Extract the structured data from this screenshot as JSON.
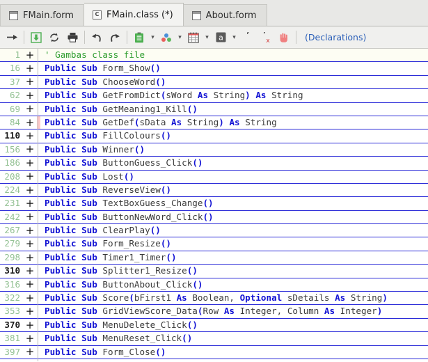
{
  "window": {
    "app": "Gambas IDE code editor"
  },
  "tabs": [
    {
      "label": "FMain.form",
      "icon": "form-window-icon",
      "icon_letter": "",
      "active": false
    },
    {
      "label": "FMain.class (*)",
      "icon": "class-file-icon",
      "icon_letter": "C",
      "active": true
    },
    {
      "label": "About.form",
      "icon": "form-window-icon",
      "icon_letter": "",
      "active": false
    }
  ],
  "toolbar": {
    "buttons": [
      {
        "name": "go-to-icon",
        "glyph": "→",
        "color": "#3c3c3c"
      },
      {
        "name": "save-icon",
        "glyph": "⬇",
        "color": "#4caf50"
      },
      {
        "name": "reload-icon",
        "glyph": "↻",
        "color": "#3c3c3c"
      },
      {
        "name": "print-icon",
        "glyph": "🖶",
        "color": "#3c3c3c"
      },
      {
        "name": "undo-icon",
        "glyph": "↶",
        "color": "#3c3c3c"
      },
      {
        "name": "redo-icon",
        "glyph": "↷",
        "color": "#3c3c3c"
      },
      {
        "name": "clipboard-icon",
        "glyph": "📋",
        "color": "#4caf50"
      },
      {
        "name": "breakpoints-icon",
        "glyph": "●",
        "color": "#4a90d9"
      },
      {
        "name": "calendar-icon",
        "glyph": "▦",
        "color": "#555555"
      },
      {
        "name": "font-icon",
        "glyph": "a",
        "color": "#555555"
      },
      {
        "name": "comment-icon",
        "glyph": "’",
        "color": "#3c3c3c"
      },
      {
        "name": "uncomment-icon",
        "glyph": "’",
        "color": "#3c3c3c"
      },
      {
        "name": "stop-hand-icon",
        "glyph": "✋",
        "color": "#f08080"
      }
    ],
    "declarations_label": "(Declarations)"
  },
  "colors": {
    "keyword": "#1414d4",
    "comment": "#2f9d2f",
    "identifier": "#3a3a3a",
    "line_number": "#93c193",
    "line_number_active": "#1b1b1b",
    "row_separator": "#2b2bd8",
    "modified_marker": "#ffc9c9",
    "toolbar_bg": "#f0f0ee",
    "tab_active_bg": "#f3f3f1"
  },
  "code_lines": [
    {
      "line": "1",
      "numdark": false,
      "flag": false,
      "first": true,
      "parts": [
        {
          "t": "' Gambas class file",
          "c": "cmt"
        }
      ]
    },
    {
      "line": "16",
      "numdark": false,
      "flag": false,
      "parts": [
        {
          "t": "Public Sub ",
          "c": "kw"
        },
        {
          "t": "Form_Show",
          "c": "id"
        },
        {
          "t": "()",
          "c": "punc"
        }
      ]
    },
    {
      "line": "37",
      "numdark": false,
      "flag": false,
      "parts": [
        {
          "t": "Public Sub ",
          "c": "kw"
        },
        {
          "t": "ChooseWord",
          "c": "id"
        },
        {
          "t": "()",
          "c": "punc"
        }
      ]
    },
    {
      "line": "62",
      "numdark": false,
      "flag": false,
      "parts": [
        {
          "t": "Public Sub ",
          "c": "kw"
        },
        {
          "t": "GetFromDict",
          "c": "id"
        },
        {
          "t": "(",
          "c": "punc"
        },
        {
          "t": "sWord ",
          "c": "id"
        },
        {
          "t": "As ",
          "c": "kw"
        },
        {
          "t": "String",
          "c": "id"
        },
        {
          "t": ")",
          "c": "punc"
        },
        {
          "t": " ",
          "c": "id"
        },
        {
          "t": "As ",
          "c": "kw"
        },
        {
          "t": "String",
          "c": "id"
        }
      ]
    },
    {
      "line": "69",
      "numdark": false,
      "flag": false,
      "parts": [
        {
          "t": "Public Sub ",
          "c": "kw"
        },
        {
          "t": "GetMeaning1_Kill",
          "c": "id"
        },
        {
          "t": "()",
          "c": "punc"
        }
      ]
    },
    {
      "line": "84",
      "numdark": false,
      "flag": true,
      "parts": [
        {
          "t": "Public Sub ",
          "c": "kw"
        },
        {
          "t": "GetDef",
          "c": "id"
        },
        {
          "t": "(",
          "c": "punc"
        },
        {
          "t": "sData ",
          "c": "id"
        },
        {
          "t": "As ",
          "c": "kw"
        },
        {
          "t": "String",
          "c": "id"
        },
        {
          "t": ")",
          "c": "punc"
        },
        {
          "t": " ",
          "c": "id"
        },
        {
          "t": "As ",
          "c": "kw"
        },
        {
          "t": "String",
          "c": "id"
        }
      ]
    },
    {
      "line": "110",
      "numdark": true,
      "flag": false,
      "parts": [
        {
          "t": "Public Sub ",
          "c": "kw"
        },
        {
          "t": "FillColours",
          "c": "id"
        },
        {
          "t": "()",
          "c": "punc"
        }
      ]
    },
    {
      "line": "156",
      "numdark": false,
      "flag": false,
      "parts": [
        {
          "t": "Public Sub ",
          "c": "kw"
        },
        {
          "t": "Winner",
          "c": "id"
        },
        {
          "t": "()",
          "c": "punc"
        }
      ]
    },
    {
      "line": "186",
      "numdark": false,
      "flag": false,
      "parts": [
        {
          "t": "Public Sub ",
          "c": "kw"
        },
        {
          "t": "ButtonGuess_Click",
          "c": "id"
        },
        {
          "t": "()",
          "c": "punc"
        }
      ]
    },
    {
      "line": "208",
      "numdark": false,
      "flag": false,
      "parts": [
        {
          "t": "Public Sub ",
          "c": "kw"
        },
        {
          "t": "Lost",
          "c": "id"
        },
        {
          "t": "()",
          "c": "punc"
        }
      ]
    },
    {
      "line": "224",
      "numdark": false,
      "flag": false,
      "parts": [
        {
          "t": "Public Sub ",
          "c": "kw"
        },
        {
          "t": "ReverseView",
          "c": "id"
        },
        {
          "t": "()",
          "c": "punc"
        }
      ]
    },
    {
      "line": "231",
      "numdark": false,
      "flag": false,
      "parts": [
        {
          "t": "Public Sub ",
          "c": "kw"
        },
        {
          "t": "TextBoxGuess_Change",
          "c": "id"
        },
        {
          "t": "()",
          "c": "punc"
        }
      ]
    },
    {
      "line": "242",
      "numdark": false,
      "flag": false,
      "parts": [
        {
          "t": "Public Sub ",
          "c": "kw"
        },
        {
          "t": "ButtonNewWord_Click",
          "c": "id"
        },
        {
          "t": "()",
          "c": "punc"
        }
      ]
    },
    {
      "line": "267",
      "numdark": false,
      "flag": false,
      "parts": [
        {
          "t": "Public Sub ",
          "c": "kw"
        },
        {
          "t": "ClearPlay",
          "c": "id"
        },
        {
          "t": "()",
          "c": "punc"
        }
      ]
    },
    {
      "line": "279",
      "numdark": false,
      "flag": false,
      "parts": [
        {
          "t": "Public Sub ",
          "c": "kw"
        },
        {
          "t": "Form_Resize",
          "c": "id"
        },
        {
          "t": "()",
          "c": "punc"
        }
      ]
    },
    {
      "line": "298",
      "numdark": false,
      "flag": false,
      "parts": [
        {
          "t": "Public Sub ",
          "c": "kw"
        },
        {
          "t": "Timer1_Timer",
          "c": "id"
        },
        {
          "t": "()",
          "c": "punc"
        }
      ]
    },
    {
      "line": "310",
      "numdark": true,
      "flag": false,
      "parts": [
        {
          "t": "Public Sub ",
          "c": "kw"
        },
        {
          "t": "Splitter1_Resize",
          "c": "id"
        },
        {
          "t": "()",
          "c": "punc"
        }
      ]
    },
    {
      "line": "316",
      "numdark": false,
      "flag": false,
      "parts": [
        {
          "t": "Public Sub ",
          "c": "kw"
        },
        {
          "t": "ButtonAbout_Click",
          "c": "id"
        },
        {
          "t": "()",
          "c": "punc"
        }
      ]
    },
    {
      "line": "322",
      "numdark": false,
      "flag": false,
      "parts": [
        {
          "t": "Public Sub ",
          "c": "kw"
        },
        {
          "t": "Score",
          "c": "id"
        },
        {
          "t": "(",
          "c": "punc"
        },
        {
          "t": "bFirst1 ",
          "c": "id"
        },
        {
          "t": "As ",
          "c": "kw"
        },
        {
          "t": "Boolean, ",
          "c": "id"
        },
        {
          "t": "Optional ",
          "c": "kw"
        },
        {
          "t": "sDetails ",
          "c": "id"
        },
        {
          "t": "As ",
          "c": "kw"
        },
        {
          "t": "String",
          "c": "id"
        },
        {
          "t": ")",
          "c": "punc"
        }
      ]
    },
    {
      "line": "353",
      "numdark": false,
      "flag": false,
      "parts": [
        {
          "t": "Public Sub ",
          "c": "kw"
        },
        {
          "t": "GridViewScore_Data",
          "c": "id"
        },
        {
          "t": "(",
          "c": "punc"
        },
        {
          "t": "Row ",
          "c": "id"
        },
        {
          "t": "As ",
          "c": "kw"
        },
        {
          "t": "Integer, ",
          "c": "id"
        },
        {
          "t": "Column ",
          "c": "id"
        },
        {
          "t": "As ",
          "c": "kw"
        },
        {
          "t": "Integer",
          "c": "id"
        },
        {
          "t": ")",
          "c": "punc"
        }
      ]
    },
    {
      "line": "370",
      "numdark": true,
      "flag": false,
      "parts": [
        {
          "t": "Public Sub ",
          "c": "kw"
        },
        {
          "t": "MenuDelete_Click",
          "c": "id"
        },
        {
          "t": "()",
          "c": "punc"
        }
      ]
    },
    {
      "line": "381",
      "numdark": false,
      "flag": false,
      "parts": [
        {
          "t": "Public Sub ",
          "c": "kw"
        },
        {
          "t": "MenuReset_Click",
          "c": "id"
        },
        {
          "t": "()",
          "c": "punc"
        }
      ]
    },
    {
      "line": "397",
      "numdark": false,
      "flag": false,
      "parts": [
        {
          "t": "Public Sub ",
          "c": "kw"
        },
        {
          "t": "Form_Close",
          "c": "id"
        },
        {
          "t": "()",
          "c": "punc"
        }
      ]
    }
  ]
}
